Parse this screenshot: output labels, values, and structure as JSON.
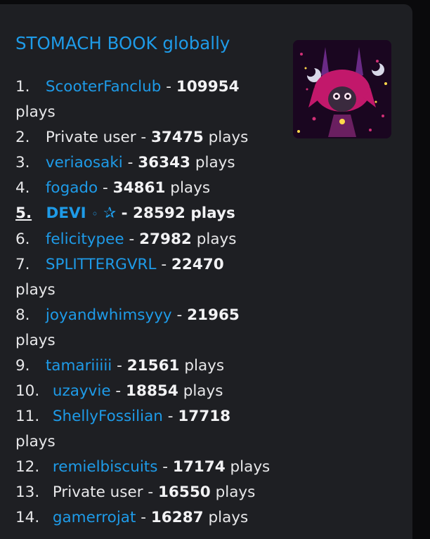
{
  "title": "STOMACH BOOK globally",
  "plays_word": "plays",
  "entries": [
    {
      "rank": "1.",
      "name": "ScooterFanclub",
      "count": "109954"
    },
    {
      "rank": "2.",
      "name": "Private user",
      "count": "37475"
    },
    {
      "rank": "3.",
      "name": "veriaosaki",
      "count": "36343"
    },
    {
      "rank": "4.",
      "name": "fogado",
      "count": "34861"
    },
    {
      "rank": "5.",
      "name": "DEVI",
      "deco": "◦",
      "star": "✰",
      "count": "28592"
    },
    {
      "rank": "6.",
      "name": "felicitypee",
      "count": "27982"
    },
    {
      "rank": "7.",
      "name": "SPLITTERGVRL",
      "count": "22470"
    },
    {
      "rank": "8.",
      "name": "joyandwhimsyyy",
      "count": "21965"
    },
    {
      "rank": "9.",
      "name": "tamariiiii",
      "count": "21561"
    },
    {
      "rank": "10.",
      "name": "uzayvie",
      "count": "18854"
    },
    {
      "rank": "11.",
      "name": "ShellyFossilian",
      "count": "17718"
    },
    {
      "rank": "12.",
      "name": "remielbiscuits",
      "count": "17174"
    },
    {
      "rank": "13.",
      "name": "Private user",
      "count": "16550"
    },
    {
      "rank": "14.",
      "name": "gamerrojat",
      "count": "16287"
    }
  ],
  "thumbnail_icon": "album-art-icon"
}
